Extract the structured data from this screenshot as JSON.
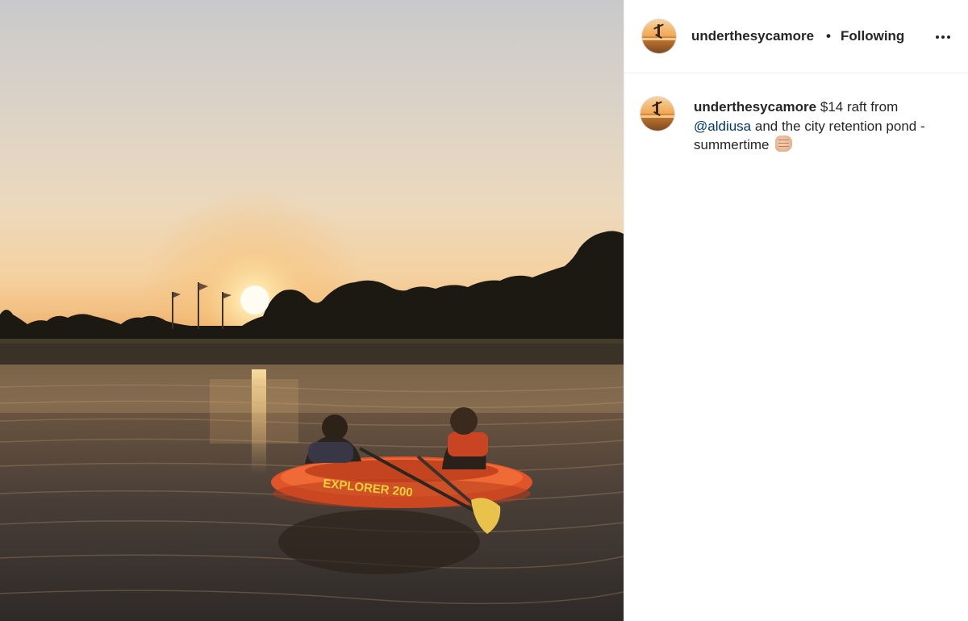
{
  "post": {
    "username": "underthesycamore",
    "separator": "•",
    "follow_status": "Following",
    "more_icon": "more-options-icon",
    "photo_description_icon": "post-photo",
    "caption": {
      "username": "underthesycamore",
      "text_before": "$14 raft from",
      "mention": "@aldiusa",
      "text_after": "and the city retention pond - summertime",
      "emoji": "fist-bump-emoji"
    },
    "photo_text": {
      "raft_label": "EXPLORER 200"
    }
  },
  "colors": {
    "link": "#00376b",
    "text": "#262626",
    "border": "#efefef"
  }
}
